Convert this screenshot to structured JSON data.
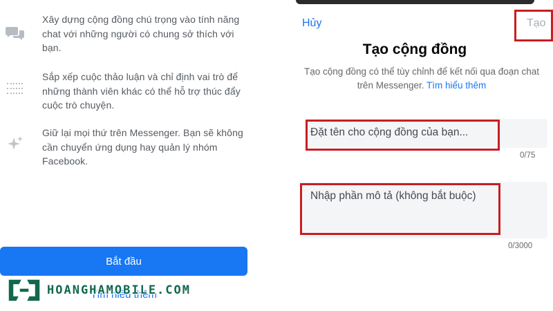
{
  "left_panel": {
    "features": [
      {
        "icon": "chat-bubbles-icon",
        "text": "Xây dựng cộng đồng chú trọng vào tính năng chat với những người có chung sở thích với bạn."
      },
      {
        "icon": "list-icon",
        "text": "Sắp xếp cuộc thảo luận và chỉ định vai trò để những thành viên khác có thể hỗ trợ thúc đẩy cuộc trò chuyện."
      },
      {
        "icon": "sparkle-icon",
        "text": "Giữ lại mọi thứ trên Messenger. Bạn sẽ không cần chuyển ứng dụng hay quản lý nhóm Facebook."
      }
    ],
    "start_button": "Bắt đầu",
    "learn_more": "Tìm hiểu thêm"
  },
  "right_panel": {
    "cancel": "Hủy",
    "create": "Tạo",
    "title": "Tạo cộng đồng",
    "description": "Tạo cộng đồng có thể tùy chỉnh để kết nối qua đoạn chat trên Messenger.",
    "learn_more": "Tìm hiểu thêm",
    "name_field": {
      "placeholder": "Đặt tên cho cộng đồng của bạn...",
      "counter": "0/75"
    },
    "description_field": {
      "placeholder": "Nhập phần mô tả (không bắt buộc)",
      "counter": "0/3000"
    }
  },
  "watermark": {
    "text": "HOANGHAMOBILE.COM"
  },
  "colors": {
    "accent": "#1877f2",
    "highlight": "#c81d22",
    "watermark": "#11694d",
    "disabled_text": "#a8adb3"
  }
}
